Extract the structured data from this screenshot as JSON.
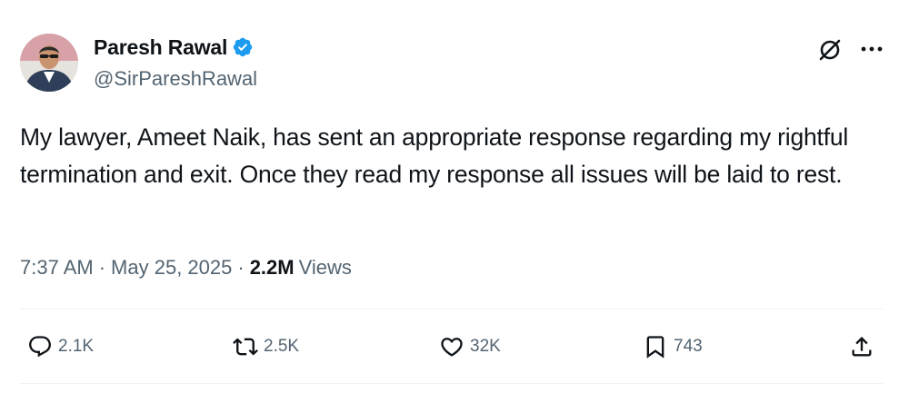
{
  "author": {
    "display_name": "Paresh Rawal",
    "handle": "@SirPareshRawal",
    "verified": true
  },
  "tweet": {
    "text": "My lawyer, Ameet Naik, has sent an appropriate response regarding my rightful termination and exit. Once they read my response all issues will be laid to rest.",
    "time": "7:37 AM",
    "separator": "·",
    "date": "May 25, 2025",
    "views_count": "2.2M",
    "views_label": "Views"
  },
  "actions": {
    "replies": "2.1K",
    "reposts": "2.5K",
    "likes": "32K",
    "bookmarks": "743"
  },
  "icons": {
    "verified": "verified-badge-icon",
    "grok": "grok-icon",
    "more": "more-icon",
    "reply": "reply-icon",
    "repost": "repost-icon",
    "like": "heart-icon",
    "bookmark": "bookmark-icon",
    "share": "share-icon"
  },
  "colors": {
    "text": "#0f1419",
    "secondary": "#536471",
    "verified": "#1d9bf0",
    "divider": "#eff3f4"
  }
}
